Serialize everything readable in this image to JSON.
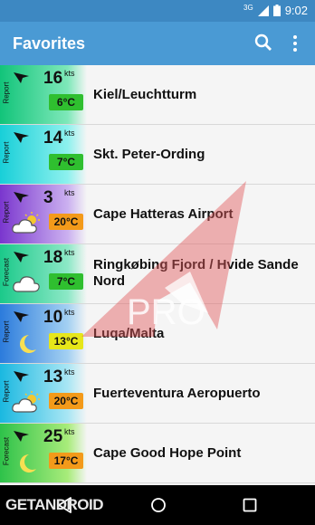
{
  "status_bar": {
    "network": "3G",
    "time": "9:02"
  },
  "app_bar": {
    "title": "Favorites"
  },
  "unit": "kts",
  "favorites": [
    {
      "type": "Report",
      "speed": "16",
      "temp": "6°C",
      "temp_color": "#2fbf2f",
      "name": "Kiel/Leuchtturm",
      "weather": "none",
      "tile_colors": [
        "#12c47a",
        "#7ee8b9"
      ]
    },
    {
      "type": "Report",
      "speed": "14",
      "temp": "7°C",
      "temp_color": "#2fbf2f",
      "name": "Skt. Peter-Ording",
      "weather": "none",
      "tile_colors": [
        "#18cfd8",
        "#8df1ee"
      ]
    },
    {
      "type": "Report",
      "speed": "3",
      "temp": "20°C",
      "temp_color": "#f39a1a",
      "name": "Cape Hatteras Airport",
      "weather": "cloud-sun",
      "tile_colors": [
        "#7a36ce",
        "#cbb0f0"
      ]
    },
    {
      "type": "Forecast",
      "speed": "18",
      "temp": "7°C",
      "temp_color": "#2fbf2f",
      "name": "Ringkøbing Fjord / Hvide Sande Nord",
      "weather": "cloud",
      "tile_colors": [
        "#1bc98a",
        "#8ce8c6"
      ]
    },
    {
      "type": "Report",
      "speed": "10",
      "temp": "13°C",
      "temp_color": "#e6e61a",
      "name": "Luqa/Malta",
      "weather": "moon",
      "tile_colors": [
        "#2b7bdc",
        "#a3d0f2"
      ]
    },
    {
      "type": "Report",
      "speed": "13",
      "temp": "20°C",
      "temp_color": "#f39a1a",
      "name": "Fuerteventura Aeropuerto",
      "weather": "cloud-sun",
      "tile_colors": [
        "#1ab8e0",
        "#a8e6f4"
      ]
    },
    {
      "type": "Forecast",
      "speed": "25",
      "temp": "17°C",
      "temp_color": "#f39a1a",
      "name": "Cape Good Hope Point",
      "weather": "moon",
      "tile_colors": [
        "#2ec24a",
        "#a8ec7a"
      ]
    }
  ],
  "watermark": {
    "text": "PRO"
  },
  "overlay": {
    "text": "GETANDROID"
  },
  "colors": {
    "status_bar": "#3d88c2",
    "app_bar": "#4a9ad4"
  }
}
